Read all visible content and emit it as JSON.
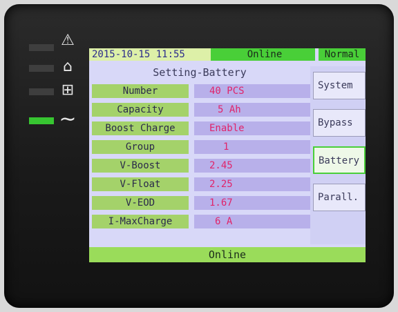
{
  "topbar": {
    "datetime": "2015-10-15 11:55",
    "state": "Online",
    "mode": "Normal"
  },
  "title": "Setting-Battery",
  "settings": [
    {
      "label": "Number",
      "value": "40  PCS"
    },
    {
      "label": "Capacity",
      "value": "5 Ah"
    },
    {
      "label": "Boost Charge",
      "value": "Enable"
    },
    {
      "label": "Group",
      "value": "1"
    },
    {
      "label": "V-Boost",
      "value": "2.45"
    },
    {
      "label": "V-Float",
      "value": "2.25"
    },
    {
      "label": "V-EOD",
      "value": "1.67"
    },
    {
      "label": "I-MaxCharge",
      "value": "6  A"
    }
  ],
  "menu": [
    {
      "label": "System",
      "selected": false
    },
    {
      "label": "Bypass",
      "selected": false
    },
    {
      "label": "Battery",
      "selected": true
    },
    {
      "label": "Parall.",
      "selected": false
    }
  ],
  "status_bar": "Online",
  "indicators": [
    {
      "icon": "warning-icon",
      "glyph": "⚠",
      "lit": false
    },
    {
      "icon": "bypass-icon",
      "glyph": "⌂",
      "lit": false
    },
    {
      "icon": "battery-icon",
      "glyph": "⊞",
      "lit": false
    },
    {
      "icon": "ac-mains-icon",
      "glyph": "∼",
      "lit": true
    }
  ],
  "colors": {
    "led_on": "#37c531",
    "online_green": "#49cf38",
    "value_text": "#e0246a"
  }
}
